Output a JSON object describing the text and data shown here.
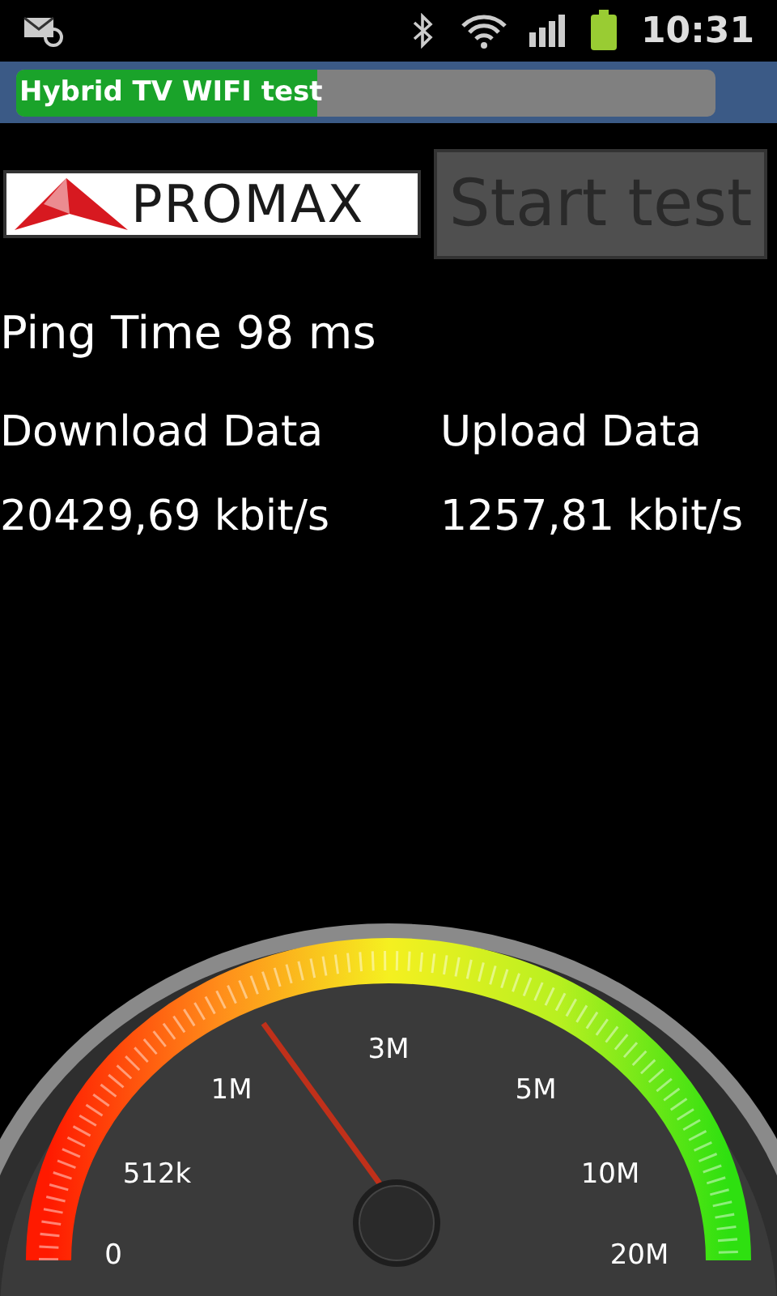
{
  "status_bar": {
    "time": "10:31"
  },
  "title_bar": {
    "title": "Hybrid TV WIFI test",
    "level": 0.43
  },
  "logo": {
    "text": "PROMAX"
  },
  "start_button": {
    "label": "Start test",
    "disabled": true
  },
  "ping": "Ping Time 98 ms",
  "results": [
    {
      "label": "Download Data",
      "value": "20429,69 kbit/s"
    },
    {
      "label": "Upload Data",
      "value": "1257,81 kbit/s"
    }
  ],
  "gauge": {
    "labels": [
      "0",
      "512k",
      "1M",
      "3M",
      "5M",
      "10M",
      "20M"
    ]
  }
}
